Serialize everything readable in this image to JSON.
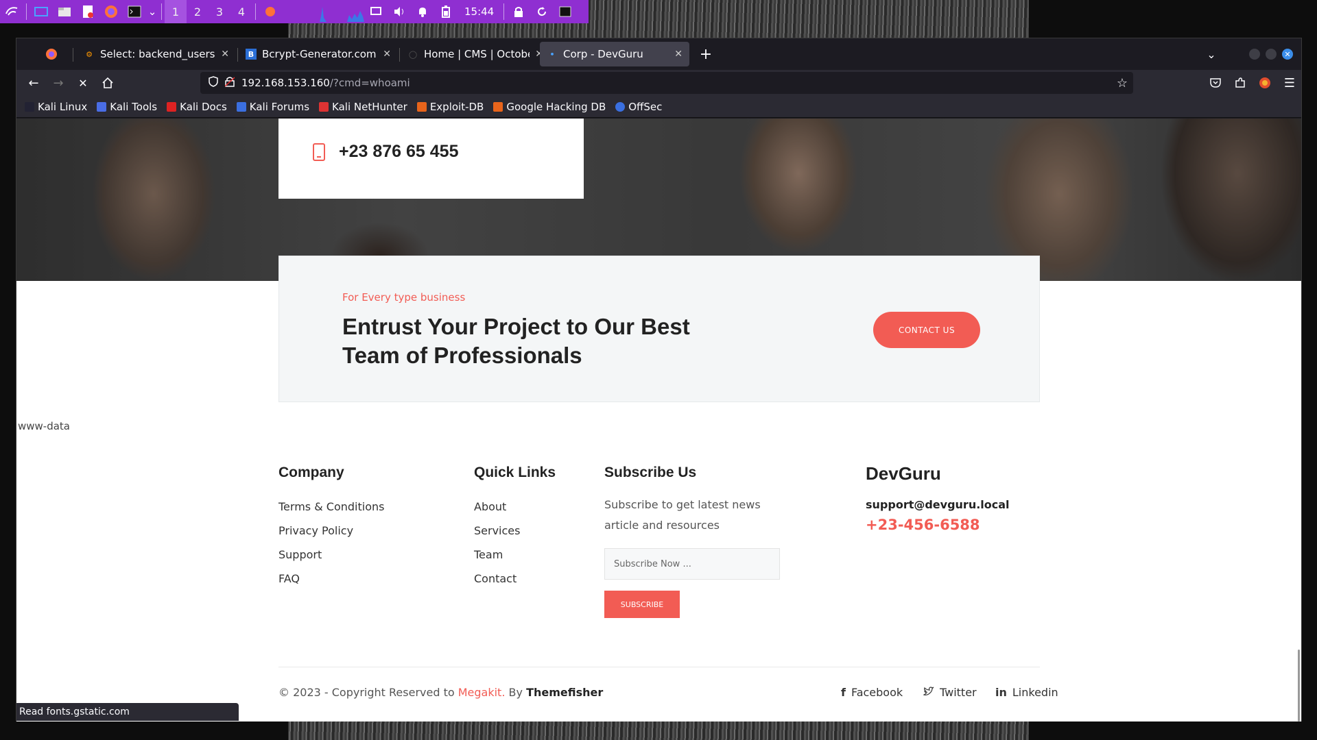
{
  "panel": {
    "workspaces": [
      "1",
      "2",
      "3",
      "4"
    ],
    "active_workspace": "1",
    "clock": "15:44",
    "accent_color": "#8f2fd1",
    "icons": [
      "kali-menu-icon",
      "show-desktop-icon",
      "file-manager-icon",
      "text-editor-icon",
      "firefox-icon",
      "terminal-icon",
      "chevron-down-icon",
      "firefox-window-icon",
      "display-icon",
      "volume-icon",
      "notification-icon",
      "battery-icon",
      "lock-icon",
      "refresh-icon",
      "terminal-tray-icon"
    ]
  },
  "tabs": [
    {
      "title": "Select: backend_users - A",
      "active": false
    },
    {
      "title": "Bcrypt-Generator.com - G",
      "active": false
    },
    {
      "title": "Home | CMS | OctoberCMS",
      "active": false
    },
    {
      "title": "Corp - DevGuru",
      "active": true
    }
  ],
  "url": {
    "host": "192.168.153.160",
    "path": "/?cmd=whoami"
  },
  "bookmarks": [
    "Kali Linux",
    "Kali Tools",
    "Kali Docs",
    "Kali Forums",
    "Kali NetHunter",
    "Exploit-DB",
    "Google Hacking DB",
    "OffSec"
  ],
  "contact_card": {
    "phone": "+23 876 65 455"
  },
  "cta": {
    "subtitle": "For Every type business",
    "title": "Entrust Your Project to Our Best Team of Professionals",
    "button": "CONTACT US"
  },
  "command_output": "www-data",
  "footer": {
    "company": {
      "heading": "Company",
      "links": [
        "Terms & Conditions",
        "Privacy Policy",
        "Support",
        "FAQ"
      ]
    },
    "quick_links": {
      "heading": "Quick Links",
      "links": [
        "About",
        "Services",
        "Team",
        "Contact"
      ]
    },
    "subscribe": {
      "heading": "Subscribe Us",
      "text": "Subscribe to get latest news article and resources",
      "placeholder": "Subscribe Now ...",
      "button": "SUBSCRIBE"
    },
    "brand": {
      "name": "DevGuru",
      "email": "support@devguru.local",
      "phone": "+23-456-6588"
    },
    "copyright": {
      "prefix": "© 2023 - Copyright Reserved to",
      "link": "Megakit.",
      "by": "By",
      "author": "Themefisher"
    },
    "social": [
      "Facebook",
      "Twitter",
      "Linkedin"
    ]
  },
  "status_text": "Read fonts.gstatic.com",
  "colors": {
    "accent": "#f25c54",
    "browser_bg": "#1c1b22"
  }
}
